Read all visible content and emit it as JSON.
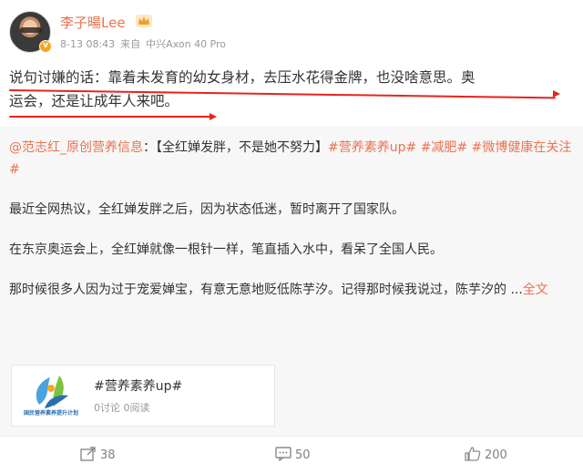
{
  "post": {
    "author": "李子暘Lee",
    "verified_badge": "v",
    "time": "8-13 08:43",
    "source_prefix": "来自",
    "device": "中兴Axon 40 Pro",
    "text_line1": "说句讨嫌的话：靠着未发育的幼女身材，去压水花得金牌，也没啥意思。奥",
    "text_line2": "运会，还是让成年人来吧。",
    "underline_color": "#e8231d"
  },
  "repost": {
    "author_mention": "@范志红_原创营养信息",
    "colon": "：",
    "headline": "【全红婵发胖，不是她不努力】",
    "tag1": "#营养素养up#",
    "tag2": "#减肥#",
    "tag3": "#微博健康在关注#",
    "para1": "最近全网热议，全红婵发胖之后，因为状态低迷，暂时离开了国家队。",
    "para2": "在东京奥运会上，全红婵就像一根针一样，笔直插入水中，看呆了全国人民。",
    "para3": "那时候很多人因为过于宠爱婵宝，有意无意地贬低陈芋汐。记得那时候我说过，陈芋汐的 ...",
    "more_link": "全文",
    "card": {
      "title": "#营养素养up#",
      "stats": "0讨论 0阅读",
      "logo_caption": "国民营养素养提升计划"
    }
  },
  "actions": {
    "repost_count": "38",
    "comment_count": "50",
    "like_count": "200"
  },
  "colors": {
    "link": "#eb7350",
    "repost_bg": "#f7f7f7",
    "badge": "#f5a623"
  }
}
